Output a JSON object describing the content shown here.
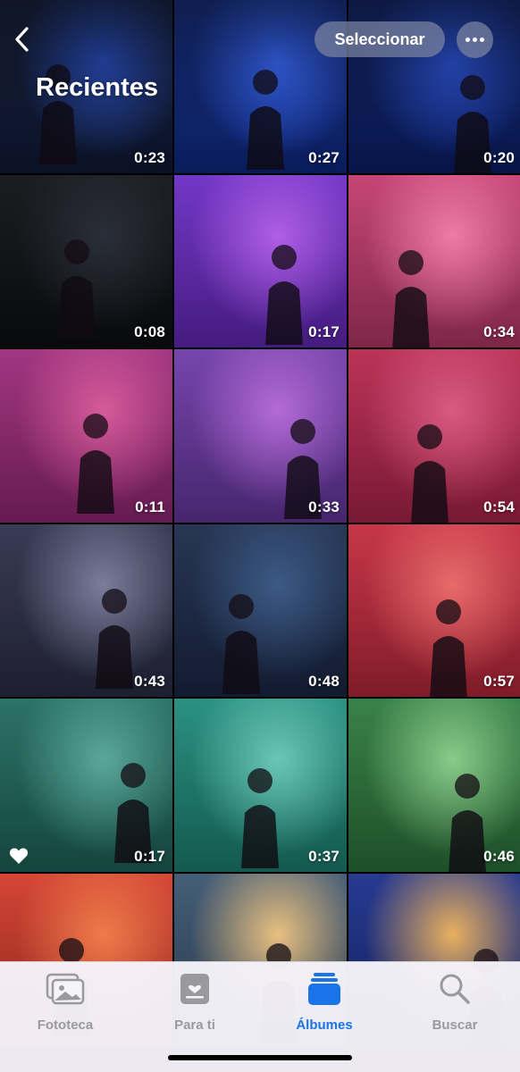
{
  "header": {
    "title": "Recientes",
    "select_label": "Seleccionar",
    "back_icon": "chevron-left-icon",
    "more_icon": "ellipsis-icon"
  },
  "photos": [
    {
      "duration": "0:23",
      "bg": "#0f1a3a",
      "glow": "#2a4fbf"
    },
    {
      "duration": "0:27",
      "bg": "#0e2a8a",
      "glow": "#3a6bff"
    },
    {
      "duration": "0:20",
      "bg": "#0a1f6e",
      "glow": "#2d55d8"
    },
    {
      "duration": "0:08",
      "bg": "#0d0f14",
      "glow": "#2a2e38"
    },
    {
      "duration": "0:17",
      "bg": "#6a2bc4",
      "glow": "#b05ee6"
    },
    {
      "duration": "0:34",
      "bg": "#c23b6e",
      "glow": "#ee7aa6"
    },
    {
      "duration": "0:11",
      "bg": "#9c2a7a",
      "glow": "#d65a9a"
    },
    {
      "duration": "0:33",
      "bg": "#6d3aa8",
      "glow": "#b46ad6"
    },
    {
      "duration": "0:54",
      "bg": "#b8274e",
      "glow": "#d95a82"
    },
    {
      "duration": "0:43",
      "bg": "#2d2f4a",
      "glow": "#7a7e9a"
    },
    {
      "duration": "0:48",
      "bg": "#1b2a4a",
      "glow": "#3c5a86"
    },
    {
      "duration": "0:57",
      "bg": "#c42a3e",
      "glow": "#e86a6a"
    },
    {
      "duration": "0:17",
      "bg": "#1f6a5e",
      "glow": "#5aa89a",
      "favorite": true
    },
    {
      "duration": "0:37",
      "bg": "#1e8a7a",
      "glow": "#6ac7b7"
    },
    {
      "duration": "0:46",
      "bg": "#2e7a3e",
      "glow": "#8acb8a"
    },
    {
      "duration": "",
      "bg": "#d23a2a",
      "glow": "#f07a4a"
    },
    {
      "duration": "",
      "bg": "#3a5470",
      "glow": "#e8c080"
    },
    {
      "duration": "",
      "bg": "#1a2e8a",
      "glow": "#e8b060"
    }
  ],
  "tabs": [
    {
      "label": "Fototeca",
      "icon": "photo-library-icon",
      "active": false
    },
    {
      "label": "Para ti",
      "icon": "for-you-icon",
      "active": false
    },
    {
      "label": "Álbumes",
      "icon": "albums-icon",
      "active": true
    },
    {
      "label": "Buscar",
      "icon": "search-icon",
      "active": false
    }
  ],
  "colors": {
    "accent": "#1a73e8",
    "tab_inactive": "#9a9a9e",
    "pill_bg": "#7882a0"
  }
}
